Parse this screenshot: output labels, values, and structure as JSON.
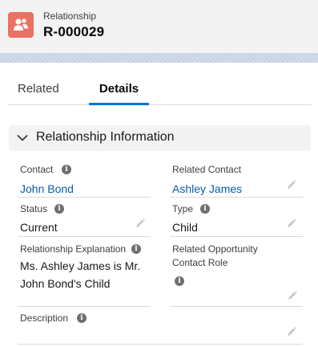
{
  "header": {
    "object_label": "Relationship",
    "record_name": "R-000029",
    "icon_color": "#ea7163"
  },
  "tabs": [
    {
      "label": "Related",
      "active": false
    },
    {
      "label": "Details",
      "active": true
    }
  ],
  "section": {
    "title": "Relationship Information",
    "expanded": true
  },
  "fields": {
    "contact": {
      "label": "Contact",
      "value": "John Bond",
      "is_link": true
    },
    "related_contact": {
      "label": "Related Contact",
      "value": "Ashley James",
      "is_link": true
    },
    "status": {
      "label": "Status",
      "value": "Current"
    },
    "type": {
      "label": "Type",
      "value": "Child"
    },
    "explanation": {
      "label": "Relationship Explanation",
      "value_line1": "Ms. Ashley James is Mr.",
      "value_line2": "John Bond's Child"
    },
    "opportunity_role": {
      "label_line1": "Related Opportunity",
      "label_line2": "Contact Role",
      "value": ""
    },
    "description": {
      "label": "Description",
      "value": ""
    }
  },
  "colors": {
    "link": "#0b5cab",
    "active_tab_underline": "#0176d3",
    "section_background": "#f3f3f3"
  },
  "icons": [
    "relationship-icon",
    "chevron-down-icon",
    "info-icon",
    "pencil-icon"
  ]
}
